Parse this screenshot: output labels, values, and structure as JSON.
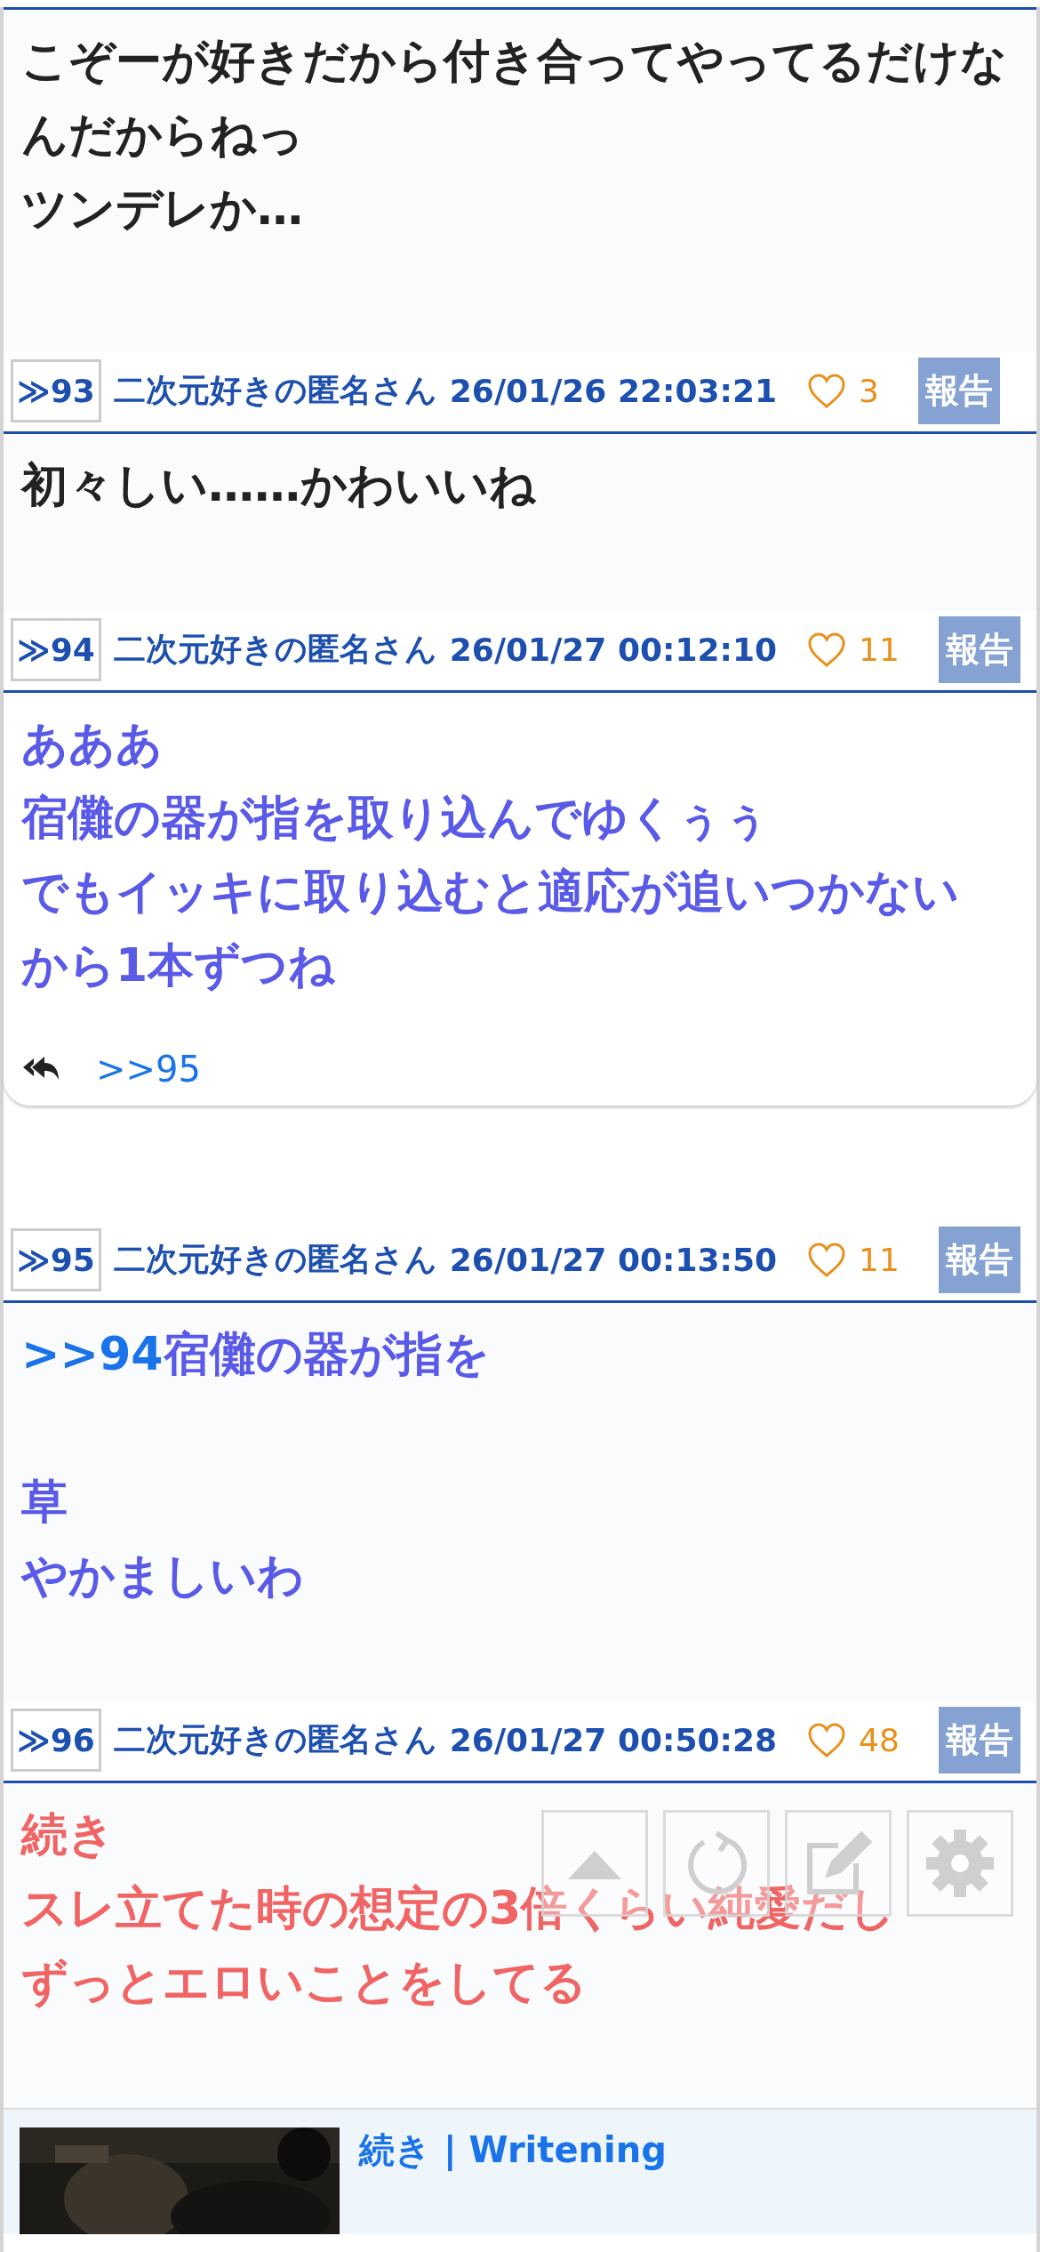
{
  "lead_body": {
    "paragraphs": [
      [
        "こぞーが好きだから付き合ってやってるだけなんだからねっ",
        "ツンデレか…"
      ]
    ],
    "color": "#222222"
  },
  "posts": [
    {
      "number": "≫93",
      "author": "二次元好きの匿名さん",
      "date": "26/01/26 22:03:21",
      "likes": "3",
      "report": "報告",
      "body": {
        "paragraphs": [
          [
            "初々しい……かわいいね"
          ]
        ],
        "color": "#222222"
      }
    },
    {
      "number": "≫94",
      "author": "二次元好きの匿名さん",
      "date": "26/01/27 00:12:10",
      "likes": "11",
      "report": "報告",
      "body": {
        "paragraphs": [
          [
            "あああ",
            "宿儺の器が指を取り込んでゆくぅぅ",
            "でもイッキに取り込むと適応が追いつかない",
            "から1本ずつね"
          ]
        ],
        "color": "#5a5ae8",
        "replies": [
          ">>95"
        ]
      }
    },
    {
      "number": "≫95",
      "author": "二次元好きの匿名さん",
      "date": "26/01/27 00:13:50",
      "likes": "11",
      "report": "報告",
      "body": {
        "quote": ">>94",
        "paragraphs": [
          [
            "宿儺の器が指を"
          ],
          [
            "草",
            "やかましいわ"
          ]
        ],
        "color": "#5a5ae8"
      }
    },
    {
      "number": "≫96",
      "author": "二次元好きの匿名さん",
      "date": "26/01/27 00:50:28",
      "likes": "48",
      "report": "報告",
      "body": {
        "paragraphs": [
          [
            "続き",
            "スレ立てた時の想定の3倍くらい純愛だし",
            "ずっとエロいことをしてる"
          ]
        ],
        "color": "#f06464"
      }
    }
  ],
  "link_card": {
    "title": "続き | Writening"
  },
  "toolbar": [
    {
      "kind": "top"
    },
    {
      "kind": "reload"
    },
    {
      "kind": "write"
    },
    {
      "kind": "settings"
    }
  ]
}
